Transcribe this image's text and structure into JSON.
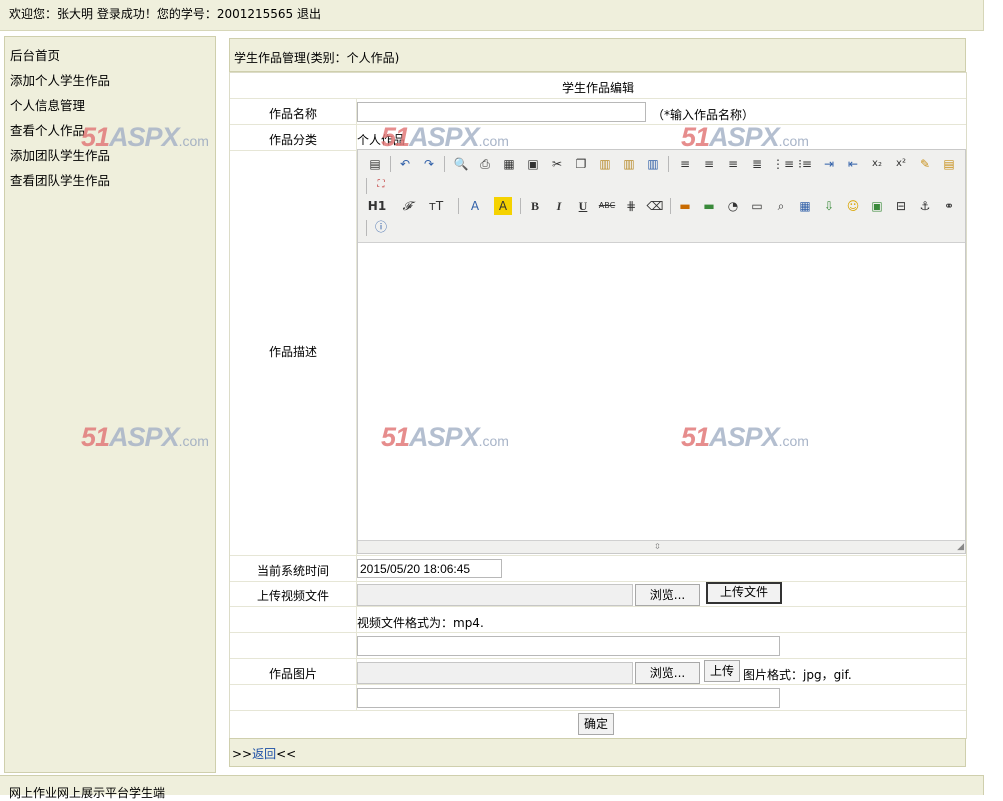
{
  "topbar": {
    "welcome": "欢迎您：张大明 登录成功！您的学号：2001215565",
    "logout": "退出"
  },
  "sidebar": {
    "items": [
      "后台首页",
      "添加个人学生作品",
      "个人信息管理",
      "查看个人作品",
      "添加团队学生作品",
      "查看团队学生作品"
    ]
  },
  "section": {
    "title": "学生作品管理(类别：个人作品)"
  },
  "form": {
    "header": "学生作品编辑",
    "name_label": "作品名称",
    "name_value": "",
    "name_hint": "（*输入作品名称）",
    "category_label": "作品分类",
    "category_value": "个人作品",
    "description_label": "作品描述",
    "time_label": "当前系统时间",
    "time_value": "2015/05/20 18:06:45",
    "video_label": "上传视频文件",
    "browse_label": "浏览...",
    "upload_file_label": "上传文件",
    "video_hint": "视频文件格式为：mp4.",
    "video_path_value": "",
    "image_label": "作品图片",
    "upload_label": "上传",
    "image_hint": "图片格式：jpg，gif.",
    "image_path_value": "",
    "submit_label": "确定"
  },
  "editor": {
    "toolbar_row1": [
      "source-icon",
      "undo-icon",
      "redo-icon",
      "preview-icon",
      "print-icon",
      "template-icon",
      "code-icon",
      "cut-icon",
      "copy-icon",
      "paste-icon",
      "paste-text-icon",
      "paste-word-icon",
      "align-left-icon",
      "align-center-icon",
      "align-right-icon",
      "justify-icon",
      "ordered-list-icon",
      "unordered-list-icon",
      "indent-icon",
      "outdent-icon",
      "subscript-icon",
      "superscript-icon",
      "clear-format-icon",
      "select-all-icon",
      "fullscreen-icon"
    ],
    "toolbar_row2": [
      "H1",
      "𝓕",
      "тT",
      "A",
      "A",
      "B",
      "I",
      "U",
      "ABC"
    ],
    "help_icon": "help-icon"
  },
  "footer": {
    "prefix": ">>",
    "back_link": "返回",
    "suffix": "<<"
  },
  "bottom": {
    "text": "网上作业网上展示平台学生端"
  },
  "watermark": {
    "num": "51",
    "brand": "ASPX",
    "tld": ".com"
  }
}
